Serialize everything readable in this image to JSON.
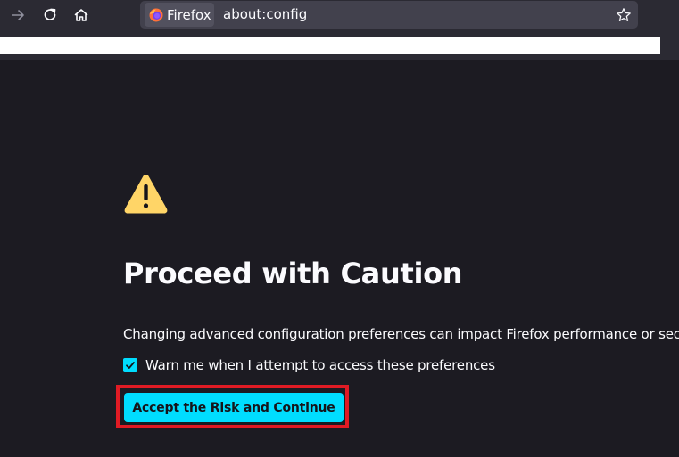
{
  "toolbar": {
    "back_icon": "arrow-back-icon",
    "reload_icon": "reload-icon",
    "home_icon": "home-icon",
    "identity_label": "Firefox",
    "url": "about:config",
    "bookmark_icon": "star-icon"
  },
  "page": {
    "warning_icon": "warning-triangle-icon",
    "heading": "Proceed with Caution",
    "description": "Changing advanced configuration preferences can impact Firefox performance or security.",
    "checkbox_label": "Warn me when I attempt to access these preferences",
    "checkbox_checked": true,
    "accept_button_label": "Accept the Risk and Continue"
  },
  "colors": {
    "background": "#1c1b22",
    "toolbar": "#2b2a33",
    "accent": "#00ddff",
    "warning": "#ffd567",
    "highlight": "#e01b24"
  }
}
